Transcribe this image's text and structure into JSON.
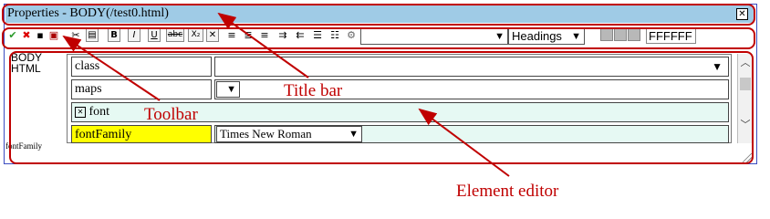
{
  "window": {
    "title": "Properties - BODY(/test0.html)",
    "close_icon": "close-icon"
  },
  "toolbar": {
    "icons": [
      "check-icon",
      "delete-icon",
      "save-icon",
      "copy-icon",
      "cut-icon",
      "image-icon",
      "bold-icon",
      "italic-icon",
      "underline-icon",
      "strikethrough-icon",
      "subscript-icon",
      "clear-format-icon",
      "align-left-icon",
      "align-center-icon",
      "align-right-icon",
      "indent-icon",
      "outdent-icon",
      "list-icon",
      "list-numbered-icon",
      "spell-check-icon"
    ],
    "bold_label": "B",
    "italic_label": "I",
    "underline_label": "U",
    "strike_label": "abc",
    "subscript_label": "X₂",
    "font_select_value": "",
    "heading_select_value": "Headings",
    "color_value": "FFFFFF"
  },
  "editor": {
    "element_label_line1": "BODY",
    "element_label_line2": "HTML",
    "status_label": "fontFamily",
    "rows": [
      {
        "name": "class",
        "value": ""
      },
      {
        "name": "maps",
        "value": ""
      },
      {
        "name": "font",
        "value": ""
      },
      {
        "name": "fontFamily",
        "value": "Times New Roman"
      }
    ]
  },
  "annotations": {
    "title_bar": "Title bar",
    "toolbar": "Toolbar",
    "element_editor": "Element editor",
    "color": "#c00000"
  }
}
